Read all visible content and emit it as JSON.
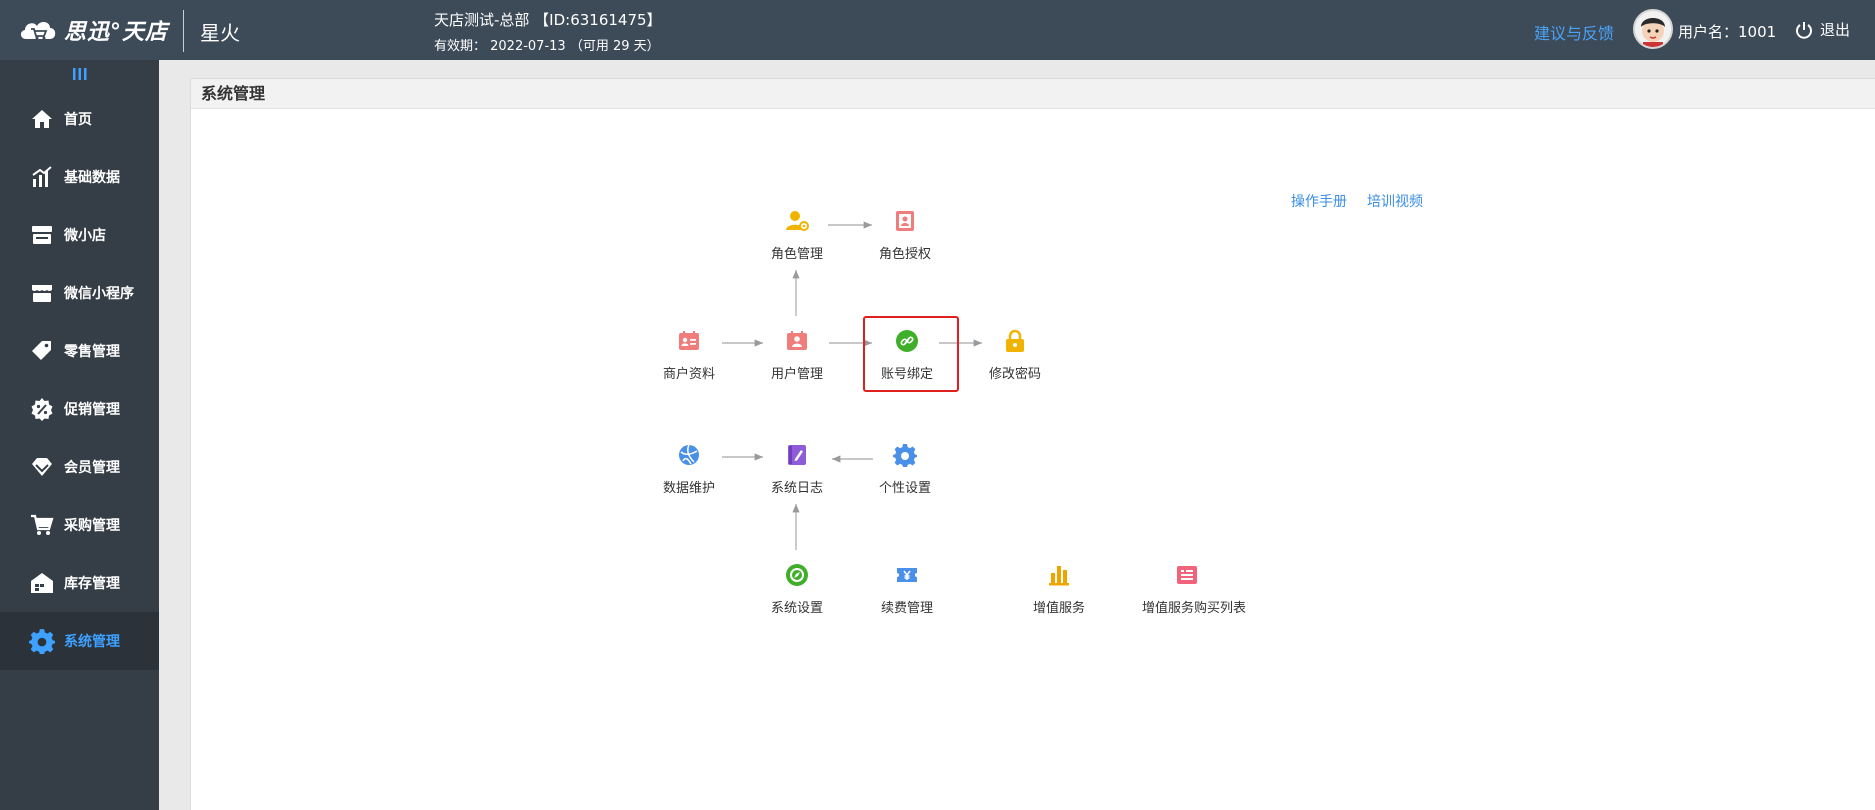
{
  "header": {
    "logo_text": "思迅°天店",
    "product": "星火",
    "store_name": "天店测试-总部 【ID:63161475】",
    "expiry": "有效期： 2022-07-13 （可用 29 天）",
    "feedback": "建议与反馈",
    "username": "用户名：1001",
    "logout": "退出"
  },
  "sidebar": {
    "items": [
      {
        "label": "首页",
        "icon": "home-icon"
      },
      {
        "label": "基础数据",
        "icon": "chart-icon"
      },
      {
        "label": "微小店",
        "icon": "store-icon"
      },
      {
        "label": "微信小程序",
        "icon": "miniapp-icon"
      },
      {
        "label": "零售管理",
        "icon": "tag-icon"
      },
      {
        "label": "促销管理",
        "icon": "percent-icon"
      },
      {
        "label": "会员管理",
        "icon": "heart-icon"
      },
      {
        "label": "采购管理",
        "icon": "cart-icon"
      },
      {
        "label": "库存管理",
        "icon": "warehouse-icon"
      },
      {
        "label": "系统管理",
        "icon": "gear-icon"
      }
    ],
    "active_index": 9
  },
  "content": {
    "title": "系统管理",
    "links": {
      "manual": "操作手册",
      "video": "培训视频"
    },
    "nodes": {
      "role_mgmt": "角色管理",
      "role_auth": "角色授权",
      "merchant_info": "商户资料",
      "user_mgmt": "用户管理",
      "account_bind": "账号绑定",
      "change_pwd": "修改密码",
      "data_maint": "数据维护",
      "sys_log": "系统日志",
      "personal_settings": "个性设置",
      "sys_settings": "系统设置",
      "renewal": "续费管理",
      "value_added": "增值服务",
      "value_added_list": "增值服务购买列表"
    }
  },
  "colors": {
    "header_bg": "#3d4a58",
    "sidebar_bg": "#353d47",
    "active_nav": "#3ea0ff",
    "link": "#3a8ee6",
    "highlight": "#e0201d"
  }
}
